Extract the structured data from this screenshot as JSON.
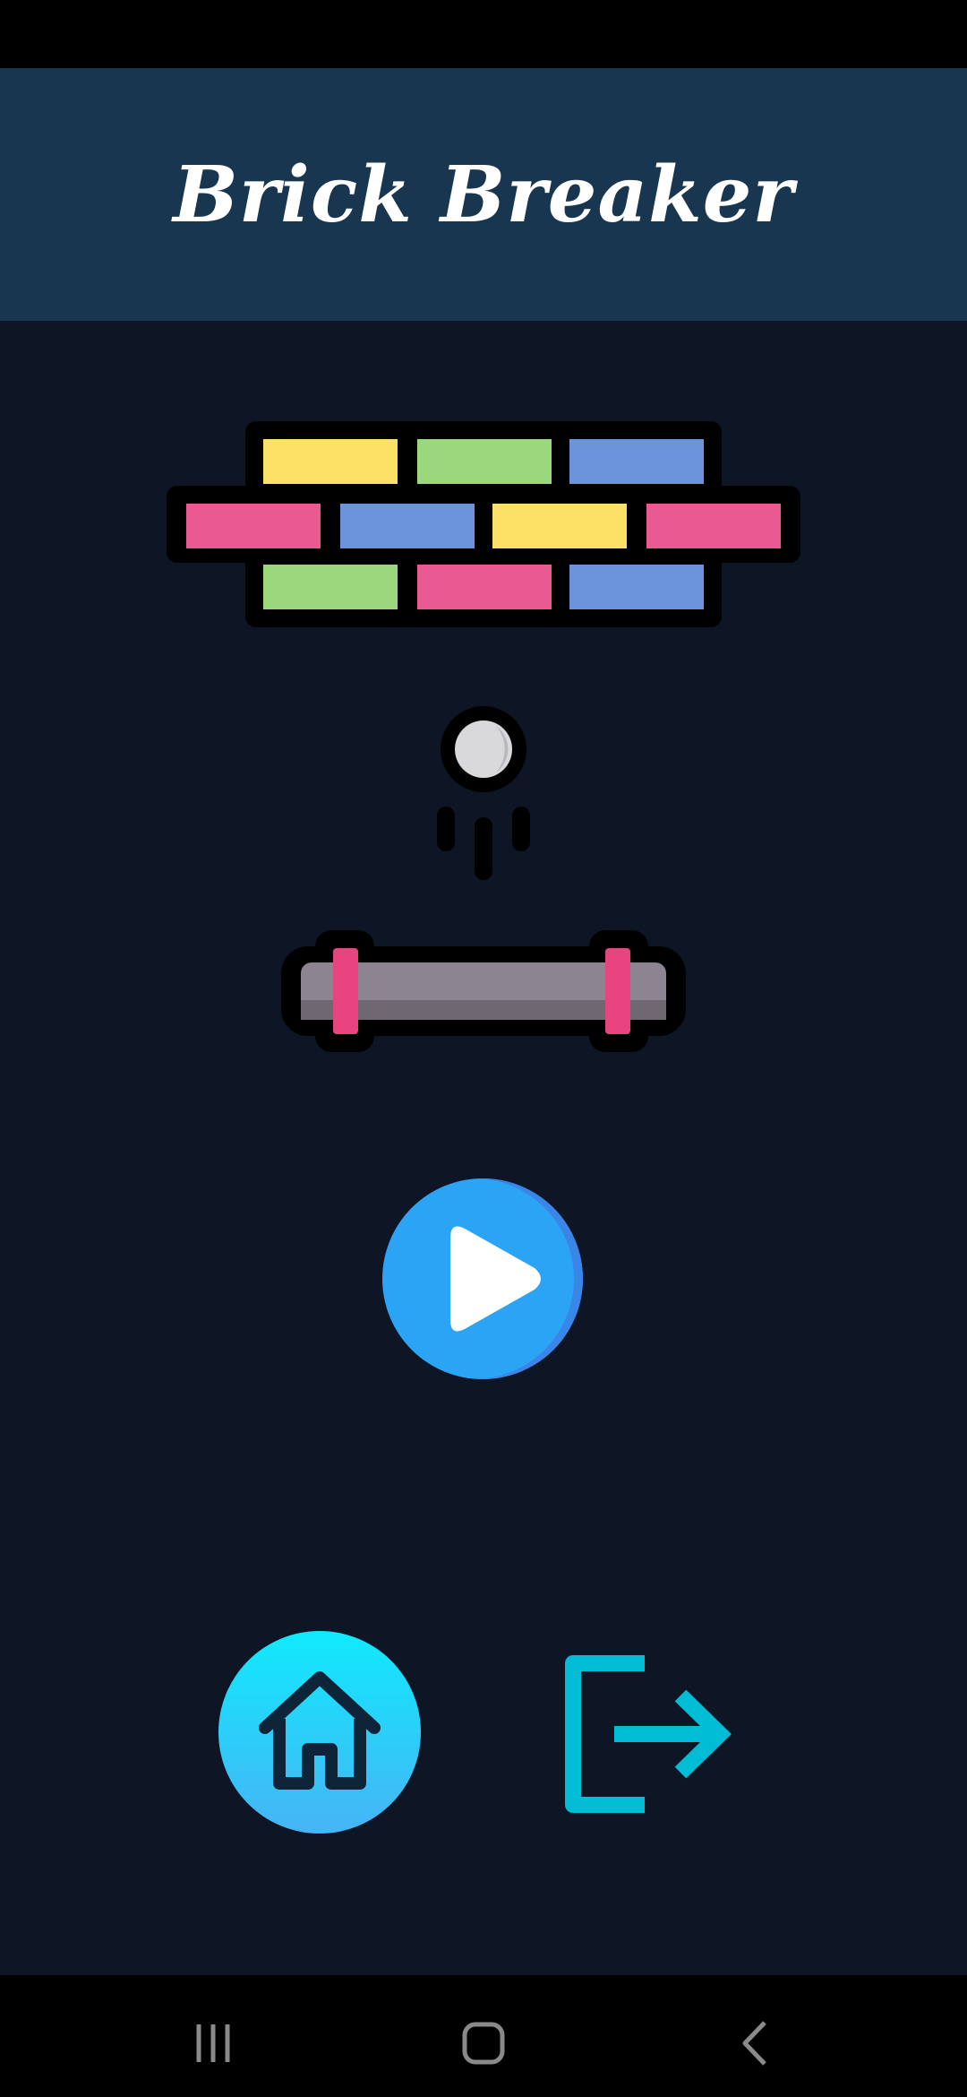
{
  "app": {
    "title": "Brick Breaker"
  },
  "icons": {
    "bricks": "brick-wall-icon",
    "ball": "bouncing-ball-icon",
    "paddle": "paddle-icon",
    "play": "play-icon",
    "home": "home-icon",
    "exit": "exit-icon",
    "nav_recents": "recents-icon",
    "nav_home": "nav-home-icon",
    "nav_back": "back-icon"
  },
  "colors": {
    "background": "#0e1626",
    "header": "#18364f",
    "brick_yellow": "#fde066",
    "brick_green": "#9bd77c",
    "brick_blue": "#6b94dc",
    "brick_pink": "#e95a92",
    "play_button": "#2ba4f5",
    "home_button_top": "#10eafc",
    "home_button_bottom": "#46b4f5",
    "exit_icon": "#00bcd4"
  }
}
